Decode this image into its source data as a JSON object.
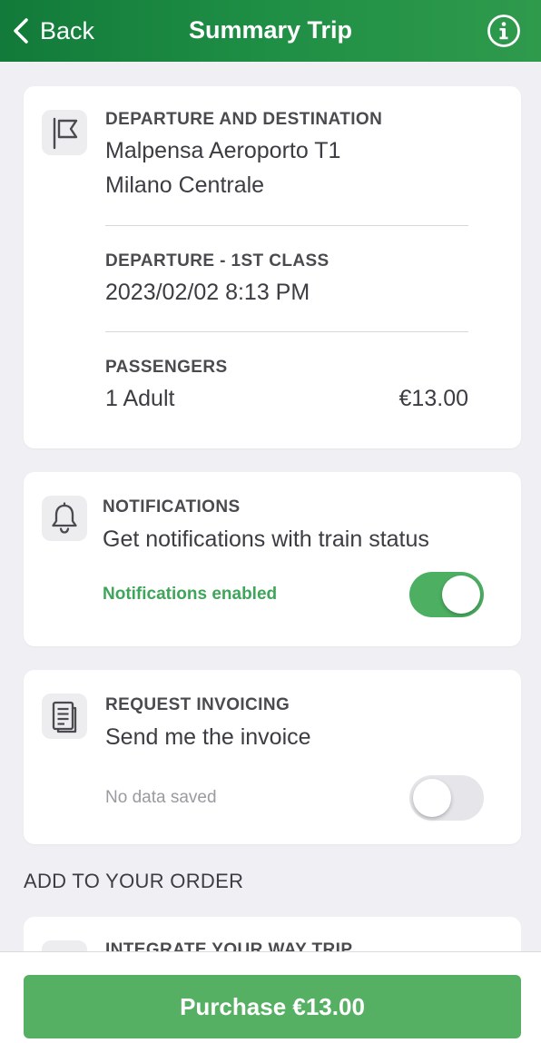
{
  "header": {
    "back_label": "Back",
    "title": "Summary Trip",
    "icons": {
      "back": "chevron-left-icon",
      "info": "info-circle-icon"
    }
  },
  "trip": {
    "route_label": "DEPARTURE AND DESTINATION",
    "origin": "Malpensa Aeroporto T1",
    "destination": "Milano Centrale",
    "departure_label": "DEPARTURE - 1ST CLASS",
    "departure_datetime": "2023/02/02 8:13 PM",
    "passengers_label": "PASSENGERS",
    "passengers_value": "1 Adult",
    "passengers_price": "€13.00",
    "icon": "flag-icon"
  },
  "notifications": {
    "title": "NOTIFICATIONS",
    "description": "Get notifications with train status",
    "status": "Notifications enabled",
    "enabled": true,
    "icon": "bell-icon"
  },
  "invoicing": {
    "title": "REQUEST INVOICING",
    "description": "Send me the invoice",
    "status": "No data saved",
    "enabled": false,
    "icon": "document-icon"
  },
  "add_to_order": {
    "heading": "ADD TO YOUR ORDER",
    "peek_title": "INTEGRATE YOUR WAY TRIP"
  },
  "footer": {
    "purchase_label": "Purchase €13.00"
  },
  "colors": {
    "header_green": "#1f8f45",
    "accent_green": "#4caf62",
    "status_green": "#3fa55a",
    "button_green": "#56b063",
    "background": "#efeff4"
  }
}
